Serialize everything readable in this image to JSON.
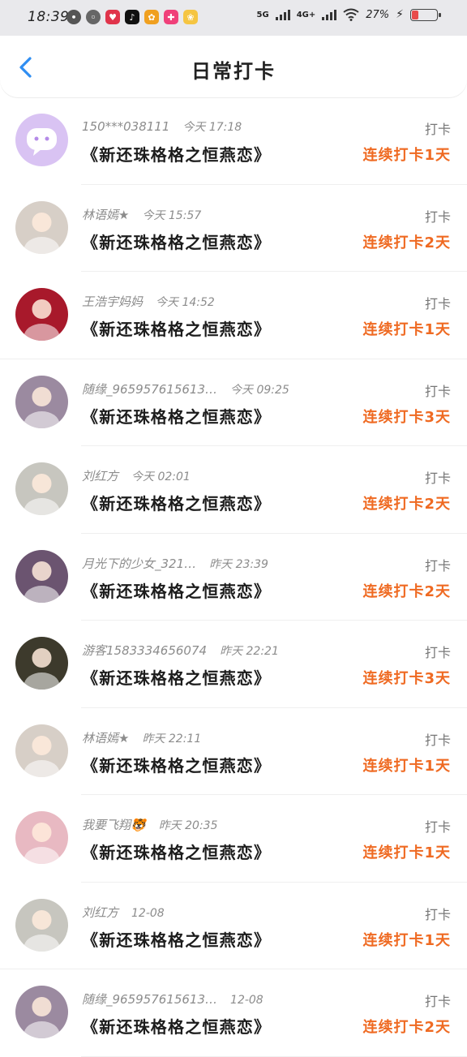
{
  "status_bar": {
    "time": "18:39",
    "network_1": "5G",
    "network_2": "4G+",
    "battery": "27%",
    "battery_level": 0.27
  },
  "header": {
    "title": "日常打卡"
  },
  "entries": [
    {
      "user": "150***038111",
      "time": "今天 17:18",
      "book": "《新还珠格格之恒燕恋》",
      "status": "打卡",
      "streak": "连续打卡1天",
      "avatar_color": "#d9c3f3"
    },
    {
      "user": "林语嫣★",
      "time": "今天 15:57",
      "book": "《新还珠格格之恒燕恋》",
      "status": "打卡",
      "streak": "连续打卡2天",
      "avatar_color": "#d7cfc7"
    },
    {
      "user": "王浩宇妈妈",
      "time": "今天 14:52",
      "book": "《新还珠格格之恒燕恋》",
      "status": "打卡",
      "streak": "连续打卡1天",
      "avatar_color": "#a8192b"
    },
    {
      "user": "随缘_965957615613…",
      "time": "今天 09:25",
      "book": "《新还珠格格之恒燕恋》",
      "status": "打卡",
      "streak": "连续打卡3天",
      "avatar_color": "#9b8aa0"
    },
    {
      "user": "刘红方",
      "time": "今天 02:01",
      "book": "《新还珠格格之恒燕恋》",
      "status": "打卡",
      "streak": "连续打卡2天",
      "avatar_color": "#c7c6bf"
    },
    {
      "user": "月光下的少女_321…",
      "time": "昨天 23:39",
      "book": "《新还珠格格之恒燕恋》",
      "status": "打卡",
      "streak": "连续打卡2天",
      "avatar_color": "#6b5470"
    },
    {
      "user": "游客1583334656074",
      "time": "昨天 22:21",
      "book": "《新还珠格格之恒燕恋》",
      "status": "打卡",
      "streak": "连续打卡3天",
      "avatar_color": "#3d3a2c"
    },
    {
      "user": "林语嫣★",
      "time": "昨天 22:11",
      "book": "《新还珠格格之恒燕恋》",
      "status": "打卡",
      "streak": "连续打卡1天",
      "avatar_color": "#d7cfc7"
    },
    {
      "user": "我要飞翔🐯",
      "time": "昨天 20:35",
      "book": "《新还珠格格之恒燕恋》",
      "status": "打卡",
      "streak": "连续打卡1天",
      "avatar_color": "#e8b9c2"
    },
    {
      "user": "刘红方",
      "time": "12-08",
      "book": "《新还珠格格之恒燕恋》",
      "status": "打卡",
      "streak": "连续打卡1天",
      "avatar_color": "#c7c6bf"
    },
    {
      "user": "随缘_965957615613…",
      "time": "12-08",
      "book": "《新还珠格格之恒燕恋》",
      "status": "打卡",
      "streak": "连续打卡2天",
      "avatar_color": "#9b8aa0"
    }
  ]
}
